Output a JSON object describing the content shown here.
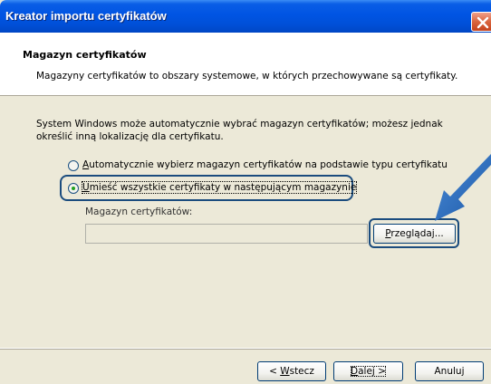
{
  "window": {
    "title": "Kreator importu certyfikatów"
  },
  "header": {
    "title": "Magazyn certyfikatów",
    "subtitle": "Magazyny certyfikatów to obszary systemowe, w których przechowywane są certyfikaty."
  },
  "content": {
    "description": "System Windows może automatycznie wybrać magazyn certyfikatów; możesz jednak określić inną lokalizację dla certyfikatu.",
    "options": [
      {
        "mnemonic": "A",
        "rest": "utomatycznie wybierz magazyn certyfikatów na podstawie typu certyfikatu",
        "selected": false
      },
      {
        "mnemonic": "U",
        "rest": "mieść wszystkie certyfikaty w następującym magazynie",
        "selected": true
      }
    ],
    "store_label": "Magazyn certyfikatów:",
    "store_value": "",
    "browse": {
      "mnemonic": "P",
      "rest": "rzeglądaj..."
    }
  },
  "footer": {
    "back": {
      "prefix": "< ",
      "mnemonic": "W",
      "rest": "stecz"
    },
    "next": {
      "mnemonic": "D",
      "rest": "alej >"
    },
    "cancel": "Anuluj"
  },
  "colors": {
    "titlebar": "#0054e3",
    "highlight": "#1b4c7e",
    "arrow": "#2a6fc0",
    "dialog_bg": "#ece9d8"
  }
}
